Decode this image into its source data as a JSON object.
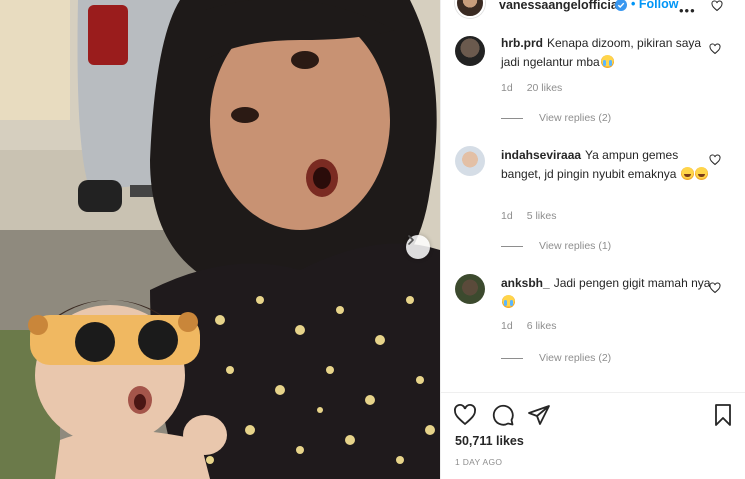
{
  "post": {
    "username": "vanessaangelofficial",
    "follow_label": "Follow",
    "more_label": "•••"
  },
  "comments": [
    {
      "user": "hrb.prd",
      "text": "Kenapa dizoom, pikiran saya jadi ngelantur mba",
      "emoji": "cry",
      "age": "1d",
      "likes": "20 likes",
      "view_replies": "View replies (2)"
    },
    {
      "user": "indahseviraaa",
      "text": "Ya ampun gemes banget, jd pingin nyubit emaknya",
      "emoji": "laugh2",
      "age": "1d",
      "likes": "5 likes",
      "view_replies": "View replies (1)"
    },
    {
      "user": "anksbh_",
      "text": "Jadi pengen gigit mamah nya",
      "emoji": "cry",
      "age": "1d",
      "likes": "6 likes",
      "view_replies": "View replies (2)"
    }
  ],
  "actions": {
    "likes_count": "50,711 likes",
    "timestamp": "1 DAY AGO"
  },
  "icons": {
    "verified": "verified-badge-icon",
    "next": "chevron-right-icon",
    "like": "heart-icon",
    "comment": "comment-bubble-icon",
    "share": "paper-plane-icon",
    "save": "bookmark-icon"
  },
  "colors": {
    "accent": "#0095f6",
    "muted": "#8e8e8e",
    "text": "#262626"
  }
}
